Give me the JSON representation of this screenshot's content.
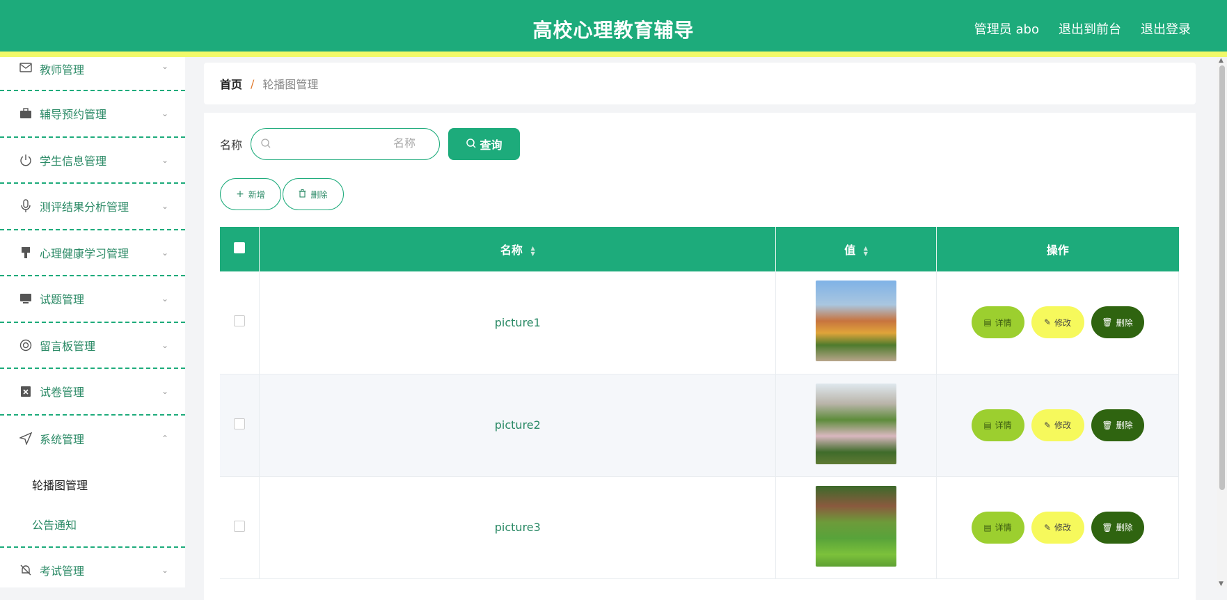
{
  "header": {
    "title": "高校心理教育辅导",
    "admin": "管理员 abo",
    "back_front": "退出到前台",
    "logout": "退出登录"
  },
  "sidebar": {
    "items": [
      {
        "label": "教师管理",
        "icon": "mail-icon"
      },
      {
        "label": "辅导预约管理",
        "icon": "briefcase-icon"
      },
      {
        "label": "学生信息管理",
        "icon": "power-icon"
      },
      {
        "label": "测评结果分析管理",
        "icon": "microphone-icon"
      },
      {
        "label": "心理健康学习管理",
        "icon": "brush-icon"
      },
      {
        "label": "试题管理",
        "icon": "monitor-icon"
      },
      {
        "label": "留言板管理",
        "icon": "lifebuoy-icon"
      },
      {
        "label": "试卷管理",
        "icon": "clipboard-x-icon"
      },
      {
        "label": "系统管理",
        "icon": "navigation-icon"
      }
    ],
    "sub_items": [
      {
        "label": "轮播图管理"
      },
      {
        "label": "公告通知"
      }
    ],
    "last_item": {
      "label": "考试管理",
      "icon": "bell-off-icon"
    }
  },
  "breadcrumb": {
    "home": "首页",
    "separator": "/",
    "current": "轮播图管理"
  },
  "search": {
    "label": "名称",
    "placeholder": "名称",
    "value": "",
    "query_label": "查询"
  },
  "toolbar": {
    "add_label": "新增",
    "delete_label": "删除"
  },
  "table": {
    "headers": {
      "name": "名称",
      "value": "值",
      "ops": "操作"
    },
    "rows": [
      {
        "name": "picture1"
      },
      {
        "name": "picture2"
      },
      {
        "name": "picture3"
      }
    ],
    "ops": {
      "detail": "详情",
      "edit": "修改",
      "delete": "删除"
    }
  },
  "colors": {
    "primary": "#1dab7b",
    "accent_bar": "#f1f969",
    "detail": "#9ccf2f",
    "edit": "#f6f95c",
    "delete": "#2f6410"
  }
}
